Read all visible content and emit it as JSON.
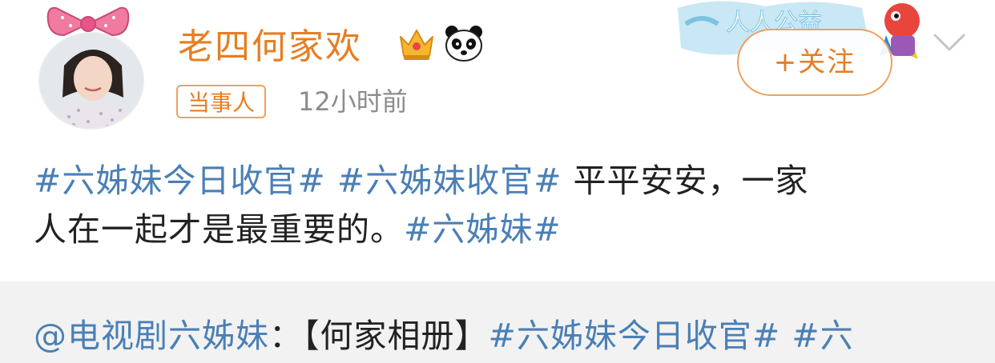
{
  "header": {
    "username": "老四何家欢",
    "role_badge": "当事人",
    "time": "12小时前",
    "follow_label": "+关注",
    "banner_text": "人人公益"
  },
  "post": {
    "line1": {
      "topic1": "#六姊妹今日收官#",
      "sep": " ",
      "topic2": "#六姊妹收官#",
      "text": " 平平安安，一家"
    },
    "line2": {
      "text": "人在一起才是最重要的。",
      "topic": "#六姊妹#"
    }
  },
  "repost": {
    "mention": "@电视剧六姊妹",
    "text": "：【何家相册】",
    "topic": "#六姊妹今日收官#",
    "tail": " #六"
  },
  "colors": {
    "username": "#e67e22",
    "topic_link": "#4a7fb5",
    "body_text": "#222222",
    "meta_text": "#8c8c8c",
    "repost_bg": "#f2f2f2",
    "badge_border": "#f0a15a"
  },
  "icons": {
    "crown": "crown-icon",
    "panda": "panda-icon",
    "dropdown": "chevron-down-icon",
    "bow": "bow-icon"
  }
}
